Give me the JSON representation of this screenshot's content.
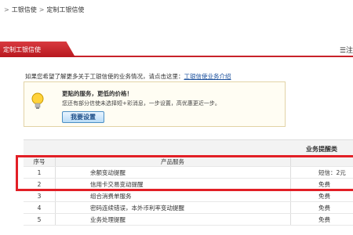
{
  "breadcrumb": {
    "sep": ">",
    "items": [
      "工银信使",
      "定制工银信使"
    ]
  },
  "tab": {
    "active_label": "定制工银信使",
    "right_label": "☰注"
  },
  "info": {
    "text": "如果您希望了解更多关于工银信使的业务情况，请点击这里：",
    "link": "工银信使业务介绍"
  },
  "promo": {
    "title": "更贴的服务，更低的价格！",
    "desc": "您还有部分信使未选择短+彩消息，一步设置，高优惠更近一步。",
    "button": "我要设置"
  },
  "table": {
    "section_title": "业务提醒类",
    "columns": [
      "序号",
      "产品服务",
      ""
    ],
    "rows": [
      {
        "no": "1",
        "name": "余额变动提醒",
        "price": "短信：2元"
      },
      {
        "no": "2",
        "name": "信用卡交易变动提醒",
        "price": "免费"
      },
      {
        "no": "3",
        "name": "组合消费单服务",
        "price": "免费"
      },
      {
        "no": "4",
        "name": "密码连续错误，本外币利率变动提醒",
        "price": "免费"
      },
      {
        "no": "5",
        "name": "业务处理提醒",
        "price": "免费"
      }
    ]
  },
  "colors": {
    "accent_red": "#c8222a",
    "highlight": "#e21f26"
  }
}
